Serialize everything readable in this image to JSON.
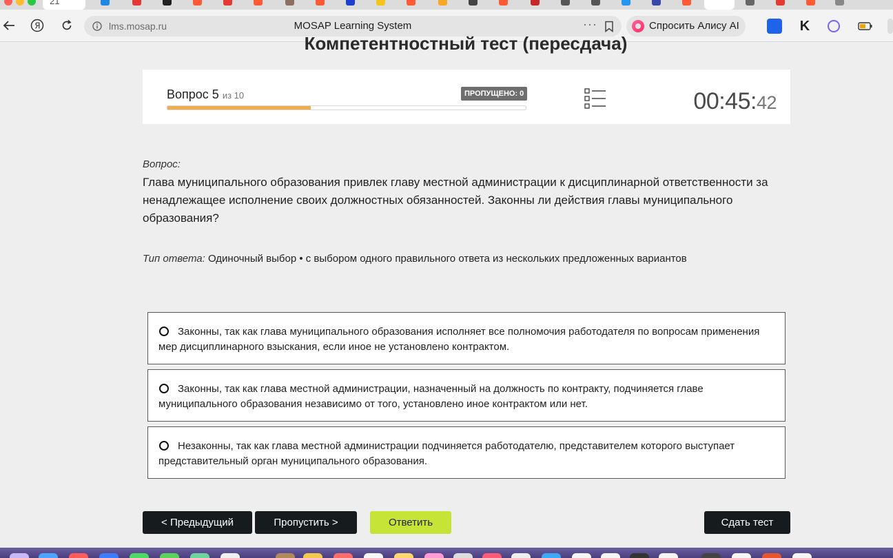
{
  "browser": {
    "address_host": "lms.mosap.ru",
    "page_title": "MOSAP Learning System",
    "alice_label": "Спросить Алису AI",
    "tab_active_label": "21"
  },
  "page": {
    "title": "Компетентностный тест (пересдача)"
  },
  "progress": {
    "question_label": "Вопрос 5",
    "question_of": "из 10",
    "skipped_badge": "ПРОПУЩЕНО: 0",
    "fraction": 0.4
  },
  "timer": {
    "main": "00:45:",
    "seconds": "42"
  },
  "question": {
    "label": "Вопрос:",
    "text": "Глава муниципального образования привлек главу местной администрации к дисциплинарной ответственности за ненадлежащее исполнение своих должностных обязанностей. Законны ли действия главы муниципального образования?",
    "answer_type_label": "Тип ответа:",
    "answer_type_value": "Одиночный выбор • с выбором одного правильного ответа из нескольких предложенных вариантов"
  },
  "options": [
    {
      "text": "Законны, так как глава муниципального образования исполняет все полномочия работодателя по вопросам применения мер дисциплинарного взыскания, если иное не установлено контрактом."
    },
    {
      "text": "Законны, так как глава местной администрации, назначенный на должность по контракту, подчиняется главе муниципального образования независимо от того, установлено иное контрактом или нет."
    },
    {
      "text": "Незаконны, так как глава местной администрации подчиняется работодателю, представителем которого выступает представительный орган муниципального образования."
    }
  ],
  "buttons": {
    "prev": "< Предыдущий",
    "skip": "Пропустить >",
    "answer": "Ответить",
    "submit": "Сдать тест"
  },
  "colors": {
    "progress_fill": "#f0ad4e",
    "answer_button": "#c6e337",
    "dark_button": "#161b1e"
  }
}
